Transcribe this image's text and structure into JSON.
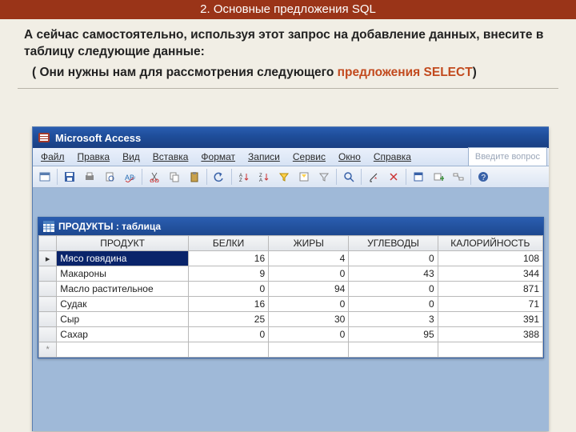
{
  "slide": {
    "header": "2. Основные предложения SQL",
    "p1a": "А сейчас самостоятельно, используя этот запрос на добавление данных, внесите в таблицу следующие данные:",
    "p2_open": "( Они нужны нам для рассмотрения следующего ",
    "p2_hi": "предложения SELECT",
    "p2_close": ")"
  },
  "access": {
    "app_title": "Microsoft Access",
    "menu": {
      "file": "Файл",
      "edit": "Правка",
      "view": "Вид",
      "insert": "Вставка",
      "format": "Формат",
      "records": "Записи",
      "tools": "Сервис",
      "window": "Окно",
      "help": "Справка"
    },
    "help_placeholder": "Введите вопрос",
    "child_title": "ПРОДУКТЫ : таблица"
  },
  "table": {
    "columns": [
      "ПРОДУКТ",
      "БЕЛКИ",
      "ЖИРЫ",
      "УГЛЕВОДЫ",
      "КАЛОРИЙНОСТЬ"
    ],
    "rows": [
      {
        "product": "Мясо говядина",
        "protein": 16,
        "fat": 4,
        "carbs": 0,
        "kcal": 108
      },
      {
        "product": "Макароны",
        "protein": 9,
        "fat": 0,
        "carbs": 43,
        "kcal": 344
      },
      {
        "product": "Масло растительное",
        "protein": 0,
        "fat": 94,
        "carbs": 0,
        "kcal": 871
      },
      {
        "product": "Судак",
        "protein": 16,
        "fat": 0,
        "carbs": 0,
        "kcal": 71
      },
      {
        "product": "Сыр",
        "protein": 25,
        "fat": 30,
        "carbs": 3,
        "kcal": 391
      },
      {
        "product": "Сахар",
        "protein": 0,
        "fat": 0,
        "carbs": 95,
        "kcal": 388
      }
    ]
  },
  "chart_data": {
    "type": "table",
    "title": "ПРОДУКТЫ",
    "columns": [
      "ПРОДУКТ",
      "БЕЛКИ",
      "ЖИРЫ",
      "УГЛЕВОДЫ",
      "КАЛОРИЙНОСТЬ"
    ],
    "rows": [
      [
        "Мясо говядина",
        16,
        4,
        0,
        108
      ],
      [
        "Макароны",
        9,
        0,
        43,
        344
      ],
      [
        "Масло растительное",
        0,
        94,
        0,
        871
      ],
      [
        "Судак",
        16,
        0,
        0,
        71
      ],
      [
        "Сыр",
        25,
        30,
        3,
        391
      ],
      [
        "Сахар",
        0,
        0,
        95,
        388
      ]
    ]
  }
}
